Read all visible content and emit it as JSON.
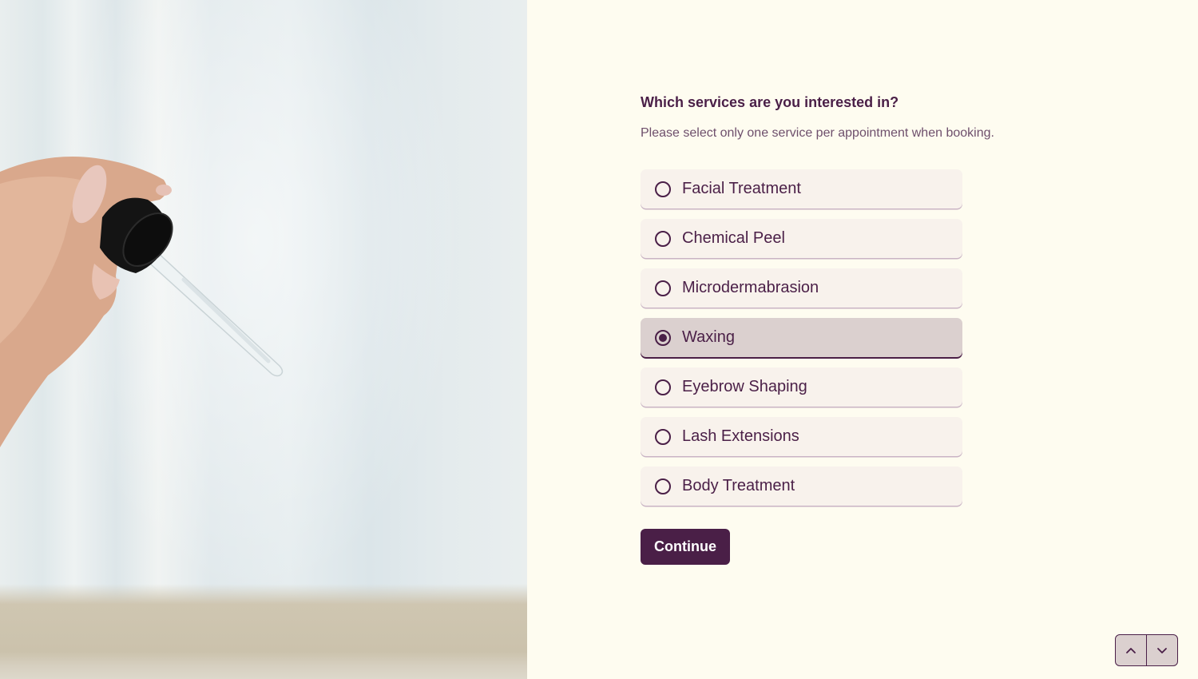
{
  "form": {
    "question": "Which services are you interested in?",
    "hint": "Please select only one service per appointment when booking.",
    "options": [
      {
        "label": "Facial Treatment",
        "selected": false
      },
      {
        "label": "Chemical Peel",
        "selected": false
      },
      {
        "label": "Microdermabrasion",
        "selected": false
      },
      {
        "label": "Waxing",
        "selected": true
      },
      {
        "label": "Eyebrow Shaping",
        "selected": false
      },
      {
        "label": "Lash Extensions",
        "selected": false
      },
      {
        "label": "Body Treatment",
        "selected": false
      }
    ],
    "selected_value": "Waxing",
    "continue_label": "Continue"
  },
  "navigation": {
    "previous_icon": "chevron-up-icon",
    "next_icon": "chevron-down-icon"
  },
  "image": {
    "subject": "hand holding a dropper pipette"
  },
  "colors": {
    "accent": "#4a1f47",
    "page_background": "#fefcf0",
    "option_background": "#f8f2ec",
    "option_selected_background": "#dbd0cf"
  }
}
